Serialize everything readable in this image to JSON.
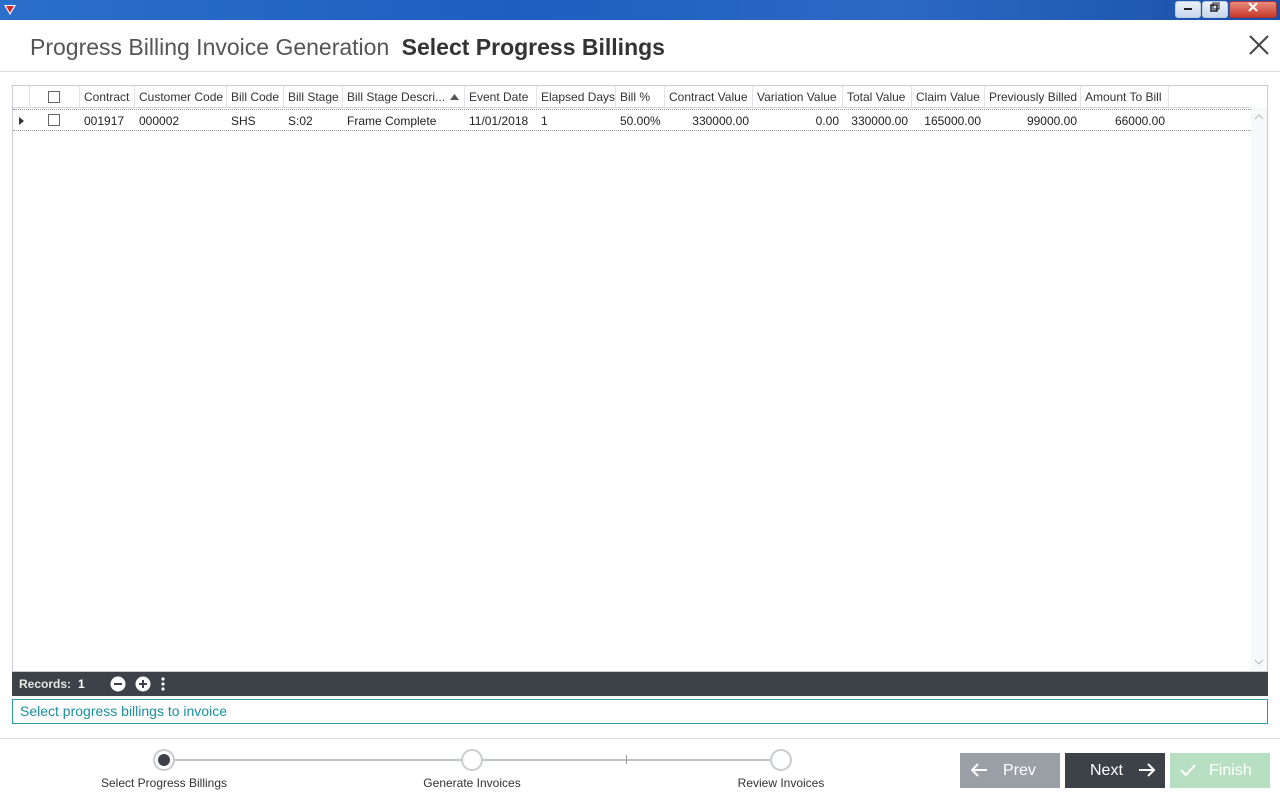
{
  "header": {
    "title": "Progress Billing Invoice Generation",
    "subtitle": "Select Progress Billings"
  },
  "grid": {
    "columns": [
      "Contract",
      "Customer Code",
      "Bill Code",
      "Bill Stage",
      "Bill Stage Descri...",
      "Event Date",
      "Elapsed Days",
      "Bill %",
      "Contract Value",
      "Variation Value",
      "Total Value",
      "Claim Value",
      "Previously Billed",
      "Amount To Bill"
    ],
    "rows": [
      {
        "contract": "001917",
        "customer_code": "000002",
        "bill_code": "SHS",
        "bill_stage": "S:02",
        "bill_stage_description": "Frame Complete",
        "event_date": "11/01/2018",
        "elapsed_days": "1",
        "bill_percent": "50.00%",
        "contract_value": "330000.00",
        "variation_value": "0.00",
        "total_value": "330000.00",
        "claim_value": "165000.00",
        "previously_billed": "99000.00",
        "amount_to_bill": "66000.00"
      }
    ]
  },
  "statusbar": {
    "records_label": "Records:",
    "records_count": "1"
  },
  "hint": "Select progress billings to invoice",
  "wizard": {
    "steps": [
      "Select Progress Billings",
      "Generate Invoices",
      "Review Invoices"
    ],
    "active_step": 0
  },
  "buttons": {
    "prev": "Prev",
    "next": "Next",
    "finish": "Finish"
  },
  "colors": {
    "dark": "#3c4248",
    "accent": "#2e9aa8",
    "finish": "#b7dfc2"
  }
}
